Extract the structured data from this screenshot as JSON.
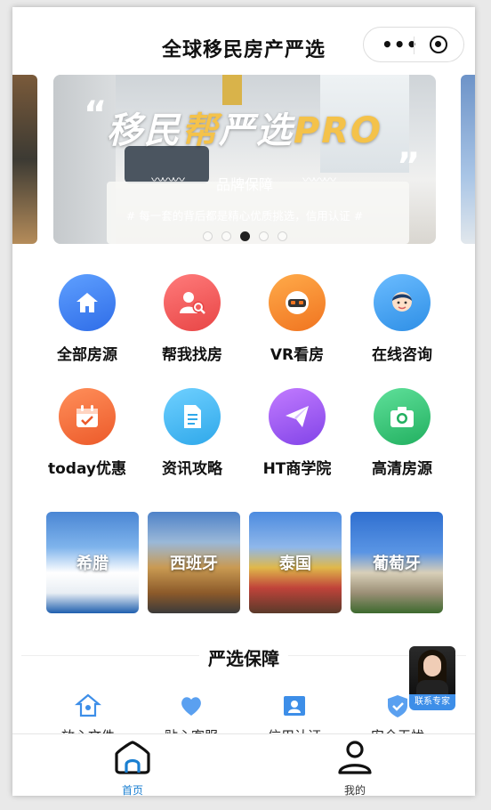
{
  "header": {
    "title": "全球移民房产严选",
    "more_icon": "more-dots-icon",
    "close_icon": "mini-program-close-icon"
  },
  "banner": {
    "headline_part1": "移民",
    "headline_part2": "帮",
    "headline_part3": "严选",
    "headline_part4": "PRO",
    "quote_open": "“",
    "quote_close": "”",
    "subtitle": "品牌保障",
    "tagline": "# 每一套的背后都是精心优质挑选，信用认证 #",
    "indicator_count": 5,
    "active_indicator": 3
  },
  "quick_menu": [
    {
      "label": "全部房源",
      "icon": "home-icon",
      "color": "#3d7ef5"
    },
    {
      "label": "帮我找房",
      "icon": "person-search-icon",
      "color": "#f25a5a"
    },
    {
      "label": "VR看房",
      "icon": "vr-headset-icon",
      "color": "#f7882a"
    },
    {
      "label": "在线咨询",
      "icon": "customer-service-icon",
      "color": "#3fa2f0"
    },
    {
      "label": "today优惠",
      "icon": "calendar-check-icon",
      "color": "#f26a3a"
    },
    {
      "label": "资讯攻略",
      "icon": "document-icon",
      "color": "#3db6f0"
    },
    {
      "label": "HT商学院",
      "icon": "paper-plane-icon",
      "color": "#9c5cf0"
    },
    {
      "label": "高清房源",
      "icon": "camera-icon",
      "color": "#33c06b"
    }
  ],
  "countries": [
    {
      "label": "希腊"
    },
    {
      "label": "西班牙"
    },
    {
      "label": "泰国"
    },
    {
      "label": "葡萄牙"
    }
  ],
  "guarantee": {
    "title": "严选保障",
    "items": [
      {
        "label": "放心文件",
        "icon": "house-key-icon"
      },
      {
        "label": "贴心客服",
        "icon": "heart-badge-icon"
      },
      {
        "label": "信用认证",
        "icon": "id-card-icon"
      },
      {
        "label": "安全无忧",
        "icon": "shield-check-icon"
      }
    ]
  },
  "expert_button": {
    "label": "联系专家"
  },
  "tabbar": {
    "home": {
      "label": "首页"
    },
    "mine": {
      "label": "我的"
    }
  },
  "colors": {
    "accent": "#1a7fd1"
  }
}
